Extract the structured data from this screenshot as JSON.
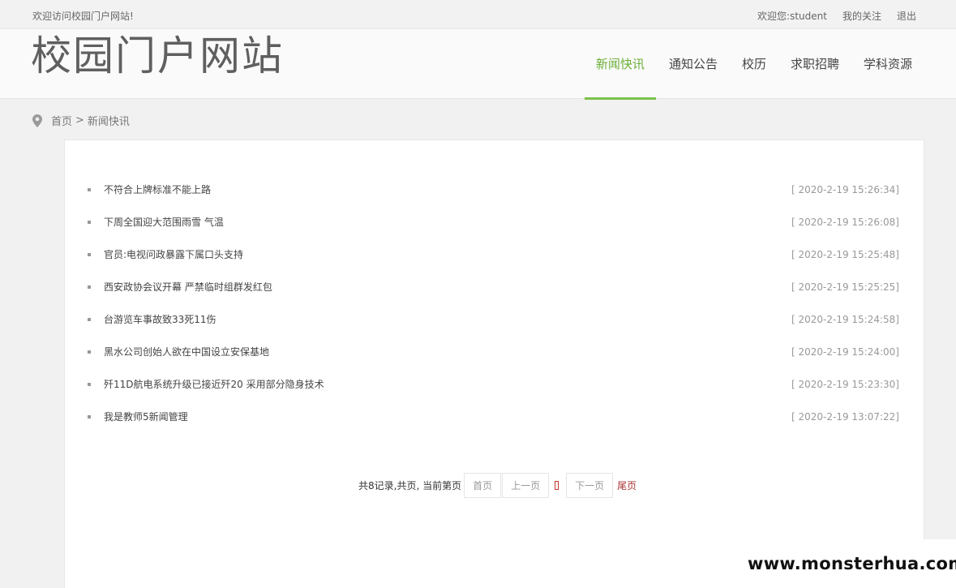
{
  "topbar": {
    "welcome": "欢迎访问校园门户网站!",
    "user_greeting": "欢迎您:student",
    "my_follow": "我的关注",
    "logout": "退出"
  },
  "header": {
    "logo": "校园门户网站",
    "nav": [
      {
        "label": "新闻快讯",
        "active": true
      },
      {
        "label": "通知公告"
      },
      {
        "label": "校历"
      },
      {
        "label": "求职招聘"
      },
      {
        "label": "学科资源"
      }
    ]
  },
  "breadcrumb": {
    "home": "首页",
    "separator": ">",
    "current": "新闻快讯",
    "icon": "location-pin-icon"
  },
  "news": [
    {
      "title": "不符合上牌标准不能上路",
      "time": "[ 2020-2-19 15:26:34]"
    },
    {
      "title": "下周全国迎大范围雨雪 气温",
      "time": "[ 2020-2-19 15:26:08]"
    },
    {
      "title": "官员:电视问政暴露下属口头支持",
      "time": "[ 2020-2-19 15:25:48]"
    },
    {
      "title": "西安政协会议开幕 严禁临时组群发红包",
      "time": "[ 2020-2-19 15:25:25]"
    },
    {
      "title": "台游览车事故致33死11伤",
      "time": "[ 2020-2-19 15:24:58]"
    },
    {
      "title": "黑水公司创始人欲在中国设立安保基地",
      "time": "[ 2020-2-19 15:24:00]"
    },
    {
      "title": "歼11D航电系统升级已接近歼20 采用部分隐身技术",
      "time": "[ 2020-2-19 15:23:30]"
    },
    {
      "title": "我是教师5新闻管理",
      "time": "[ 2020-2-19 13:07:22]"
    }
  ],
  "pager": {
    "summary": "共8记录,共页, 当前第页",
    "first": "首页",
    "prev": "上一页",
    "next": "下一页",
    "last": "尾页"
  },
  "watermark": "www.monsterhua.com",
  "colors": {
    "accent": "#7cc04b",
    "background": "#f1f1f1"
  }
}
